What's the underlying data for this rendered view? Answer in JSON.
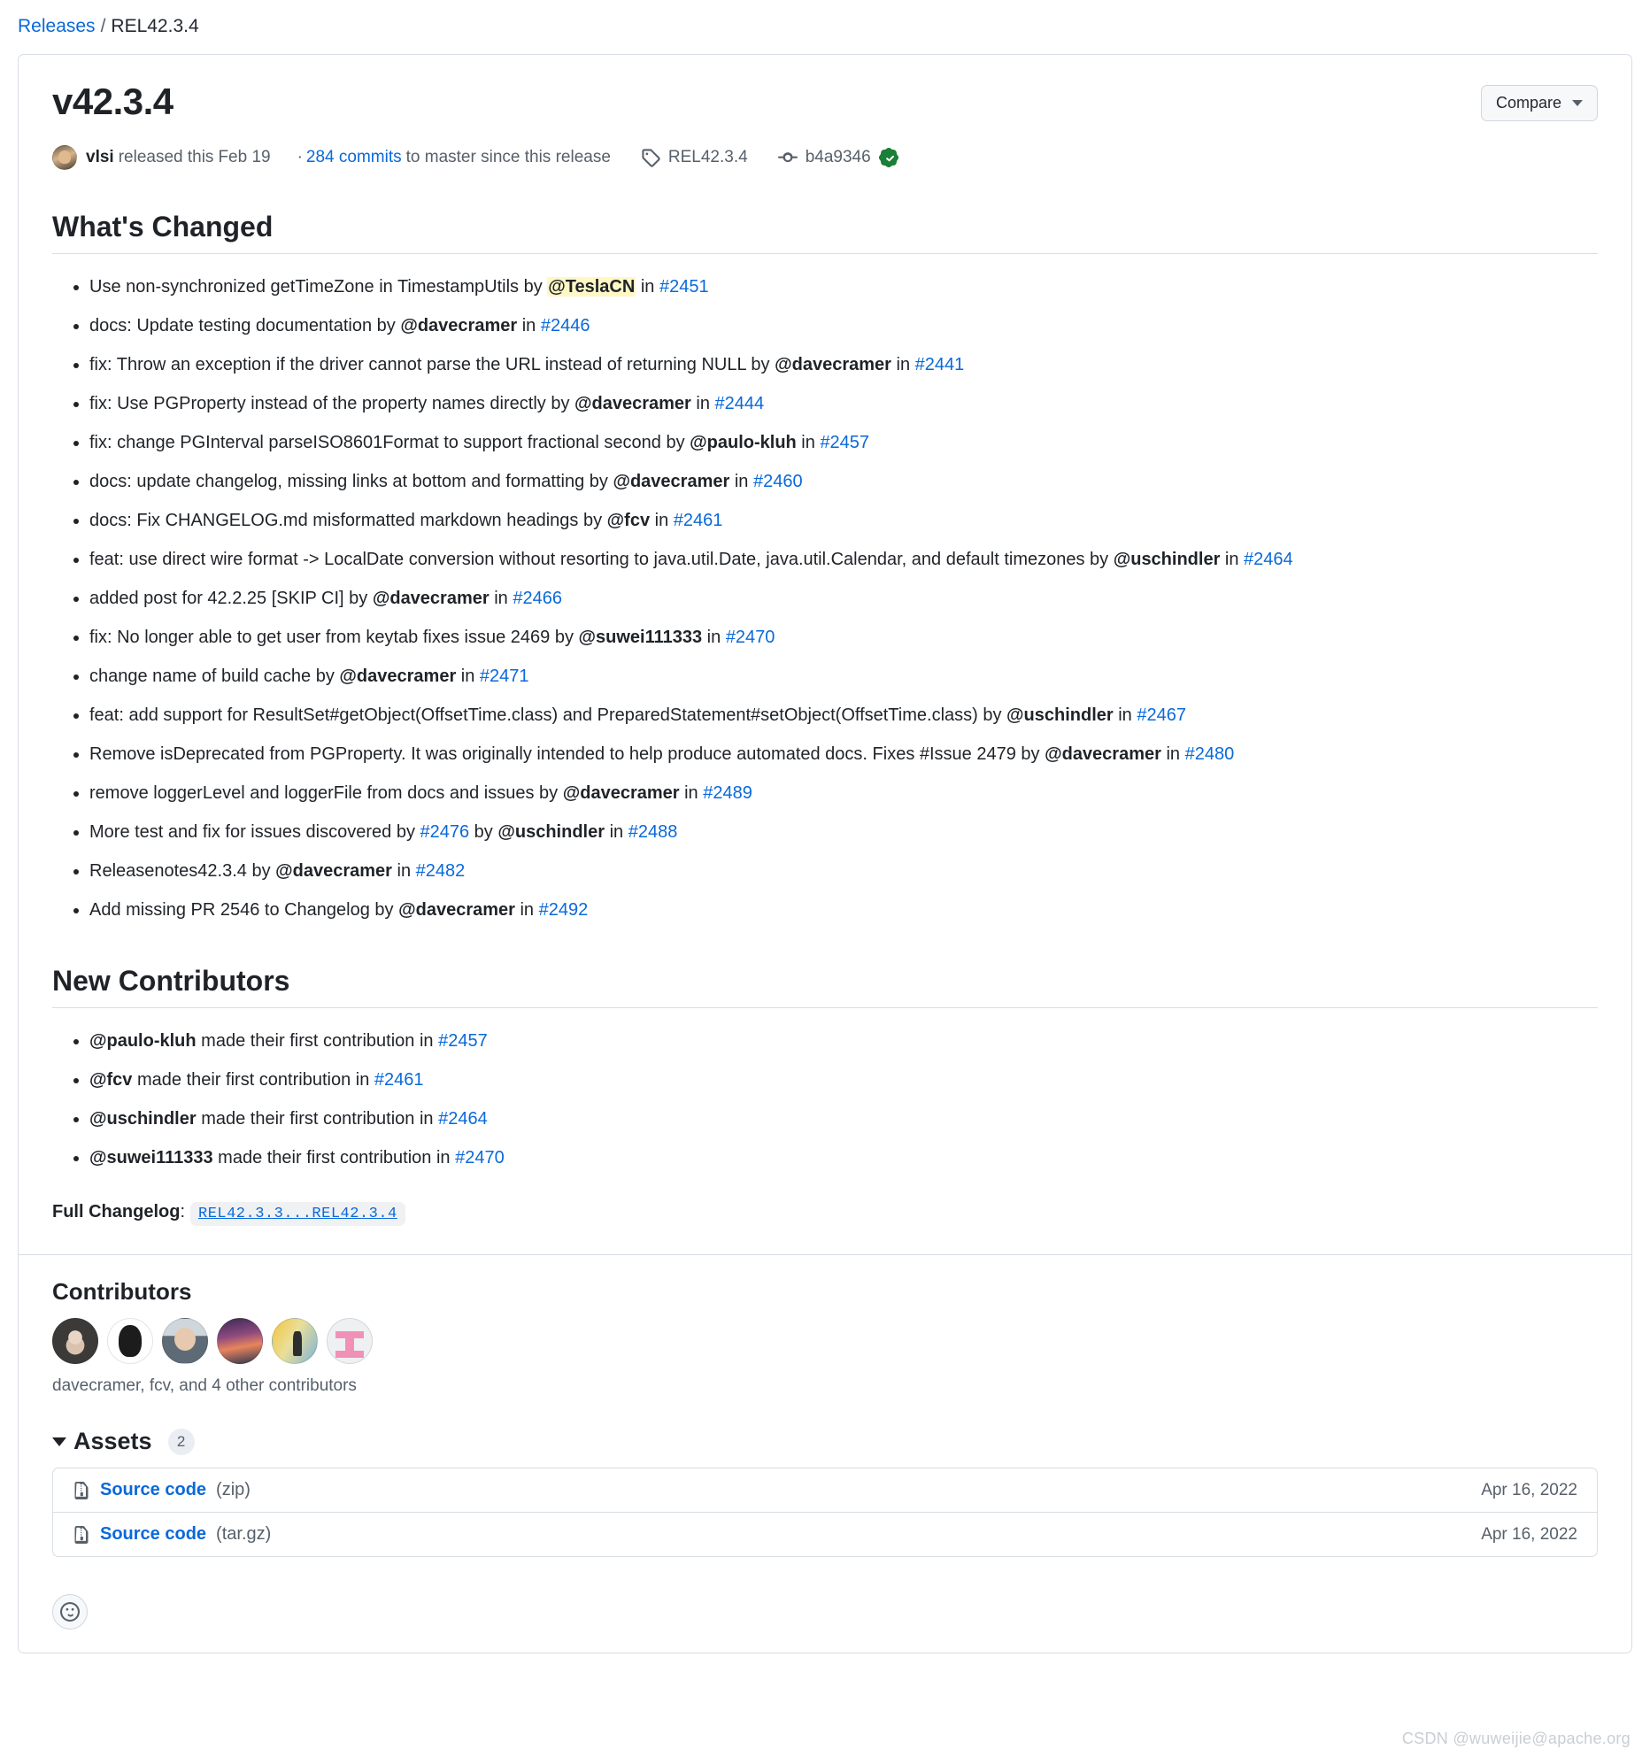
{
  "breadcrumb": {
    "releases_link": "Releases",
    "separator": "/",
    "current": "REL42.3.4"
  },
  "release": {
    "title": "v42.3.4",
    "compare_label": "Compare",
    "author": "vlsi",
    "released_text": "released this",
    "released_date": "Feb 19",
    "commits_prefix": "·",
    "commits_link": "284 commits",
    "commits_suffix": "to master since this release",
    "tag": "REL42.3.4",
    "commit_sha": "b4a9346",
    "verified_icon": "verified-check-icon",
    "tag_icon": "tag-icon",
    "commit_icon": "commit-icon"
  },
  "whats_changed": {
    "heading": "What's Changed",
    "items": [
      {
        "text": "Use non-synchronized getTimeZone in TimestampUtils by ",
        "user": "@TeslaCN",
        "highlight": true,
        "in": " in ",
        "pr": "#2451"
      },
      {
        "text": "docs: Update testing documentation by ",
        "user": "@davecramer",
        "highlight": false,
        "in": " in ",
        "pr": "#2446"
      },
      {
        "text": "fix: Throw an exception if the driver cannot parse the URL instead of returning NULL by ",
        "user": "@davecramer",
        "highlight": false,
        "in": " in ",
        "pr": "#2441"
      },
      {
        "text": "fix: Use PGProperty instead of the property names directly by ",
        "user": "@davecramer",
        "highlight": false,
        "in": " in ",
        "pr": "#2444"
      },
      {
        "text": "fix: change PGInterval parseISO8601Format to support fractional second by ",
        "user": "@paulo-kluh",
        "highlight": false,
        "in": " in ",
        "pr": "#2457"
      },
      {
        "text": "docs: update changelog, missing links at bottom and formatting by ",
        "user": "@davecramer",
        "highlight": false,
        "in": " in ",
        "pr": "#2460"
      },
      {
        "text": "docs: Fix CHANGELOG.md misformatted markdown headings by ",
        "user": "@fcv",
        "highlight": false,
        "in": " in ",
        "pr": "#2461"
      },
      {
        "text": "feat: use direct wire format -> LocalDate conversion without resorting to java.util.Date, java.util.Calendar, and default timezones by ",
        "user": "@uschindler",
        "highlight": false,
        "in": " in ",
        "pr": "#2464"
      },
      {
        "text": "added post for 42.2.25 [SKIP CI] by ",
        "user": "@davecramer",
        "highlight": false,
        "in": " in ",
        "pr": "#2466"
      },
      {
        "text": "fix: No longer able to get user from keytab fixes issue 2469 by ",
        "user": "@suwei111333",
        "highlight": false,
        "in": " in ",
        "pr": "#2470"
      },
      {
        "text": "change name of build cache by ",
        "user": "@davecramer",
        "highlight": false,
        "in": " in ",
        "pr": "#2471"
      },
      {
        "text": "feat: add support for ResultSet#getObject(OffsetTime.class) and PreparedStatement#setObject(OffsetTime.class) by ",
        "user": "@uschindler",
        "highlight": false,
        "in": " in ",
        "pr": "#2467"
      },
      {
        "text": "Remove isDeprecated from PGProperty. It was originally intended to help produce automated docs. Fixes #Issue 2479 by ",
        "user": "@davecramer",
        "highlight": false,
        "in": " in ",
        "pr": "#2480"
      },
      {
        "text": "remove loggerLevel and loggerFile from docs and issues by ",
        "user": "@davecramer",
        "highlight": false,
        "in": " in ",
        "pr": "#2489"
      },
      {
        "text": "More test and fix for issues discovered by ",
        "pre_pr": "#2476",
        "mid": " by ",
        "user": "@uschindler",
        "highlight": false,
        "in": " in ",
        "pr": "#2488"
      },
      {
        "text": "Releasenotes42.3.4 by ",
        "user": "@davecramer",
        "highlight": false,
        "in": " in ",
        "pr": "#2482"
      },
      {
        "text": "Add missing PR 2546 to Changelog by ",
        "user": "@davecramer",
        "highlight": false,
        "in": " in ",
        "pr": "#2492"
      }
    ]
  },
  "new_contributors": {
    "heading": "New Contributors",
    "items": [
      {
        "user": "@paulo-kluh",
        "text": " made their first contribution in ",
        "pr": "#2457"
      },
      {
        "user": "@fcv",
        "text": " made their first contribution in ",
        "pr": "#2461"
      },
      {
        "user": "@uschindler",
        "text": " made their first contribution in ",
        "pr": "#2464"
      },
      {
        "user": "@suwei111333",
        "text": " made their first contribution in ",
        "pr": "#2470"
      }
    ]
  },
  "full_changelog": {
    "label": "Full Changelog",
    "colon": ":",
    "value": "REL42.3.3...REL42.3.4"
  },
  "contributors": {
    "heading": "Contributors",
    "avatars": [
      "avatar-davecramer",
      "avatar-fcv",
      "avatar-uschindler",
      "avatar-vlsi",
      "avatar-paulo-kluh",
      "avatar-teslacn"
    ],
    "caption": "davecramer, fcv, and 4 other contributors"
  },
  "assets": {
    "title": "Assets",
    "count": "2",
    "rows": [
      {
        "name": "Source code",
        "ext": "(zip)",
        "date": "Apr 16, 2022",
        "icon": "file-zip-icon"
      },
      {
        "name": "Source code",
        "ext": "(tar.gz)",
        "date": "Apr 16, 2022",
        "icon": "file-zip-icon"
      }
    ]
  },
  "reactions": {
    "add_reaction_icon": "smiley-icon"
  },
  "watermark": "CSDN @wuweijie@apache.org",
  "colors": {
    "link": "#0969da",
    "text": "#1f2328",
    "muted": "#57606a",
    "border": "#d8dee4",
    "highlight": "#fff8c5",
    "verified": "#1a7f37"
  }
}
